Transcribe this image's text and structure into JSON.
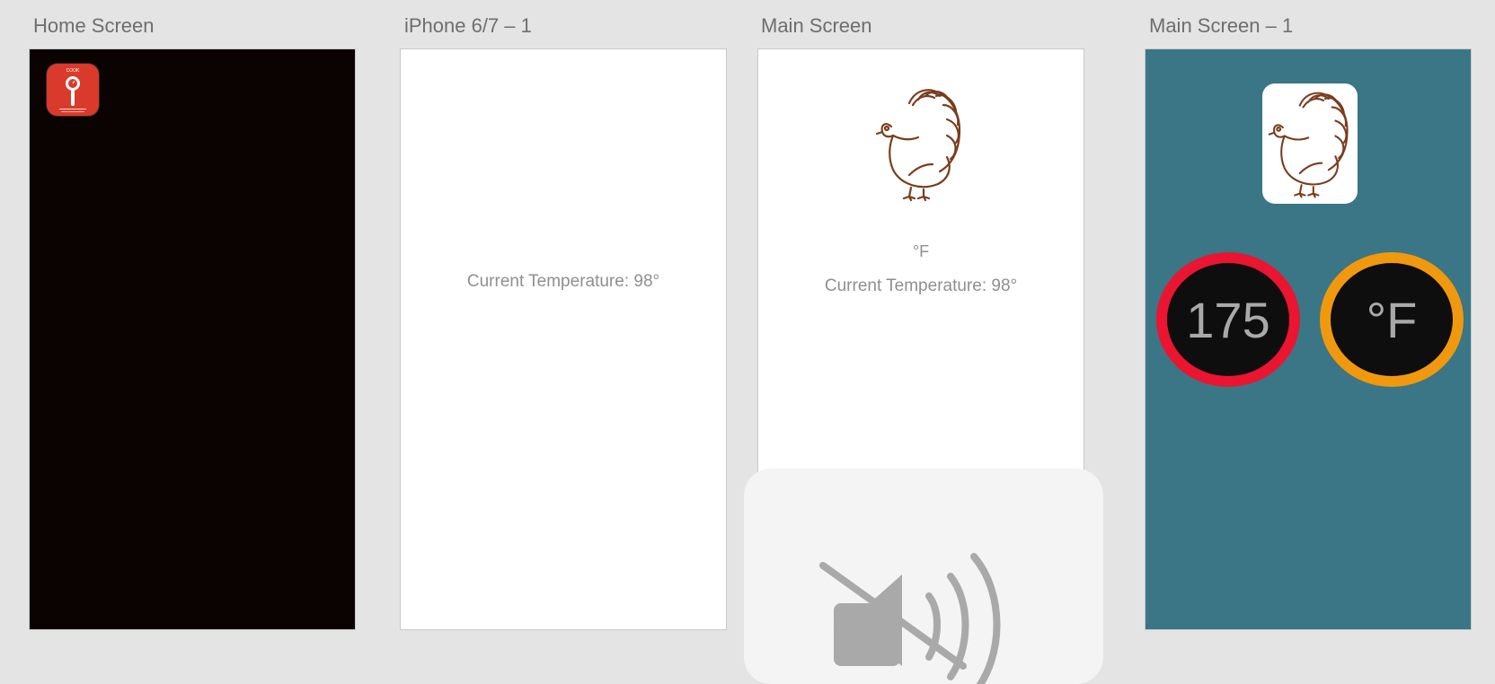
{
  "artboards": {
    "home": {
      "title": "Home Screen",
      "app_icon_text": "COOK"
    },
    "iphone": {
      "title": "iPhone 6/7 – 1",
      "temperature_text": "Current Temperature: 98°"
    },
    "main": {
      "title": "Main Screen",
      "unit_label": "°F",
      "temperature_text": "Current Temperature: 98°"
    },
    "main1": {
      "title": "Main Screen – 1",
      "dial_value": "175",
      "dial_unit": "°F"
    }
  },
  "colors": {
    "home_bg": "#0b0202",
    "app_icon": "#d93a2b",
    "main1_bg": "#3a7685",
    "dial_value_ring": "#ea1530",
    "dial_unit_ring": "#f0990f",
    "turkey_stroke": "#7a3d1e"
  },
  "icons": {
    "app": "thermometer-probe-icon",
    "turkey": "turkey-icon",
    "hud": "speaker-muted-icon"
  }
}
